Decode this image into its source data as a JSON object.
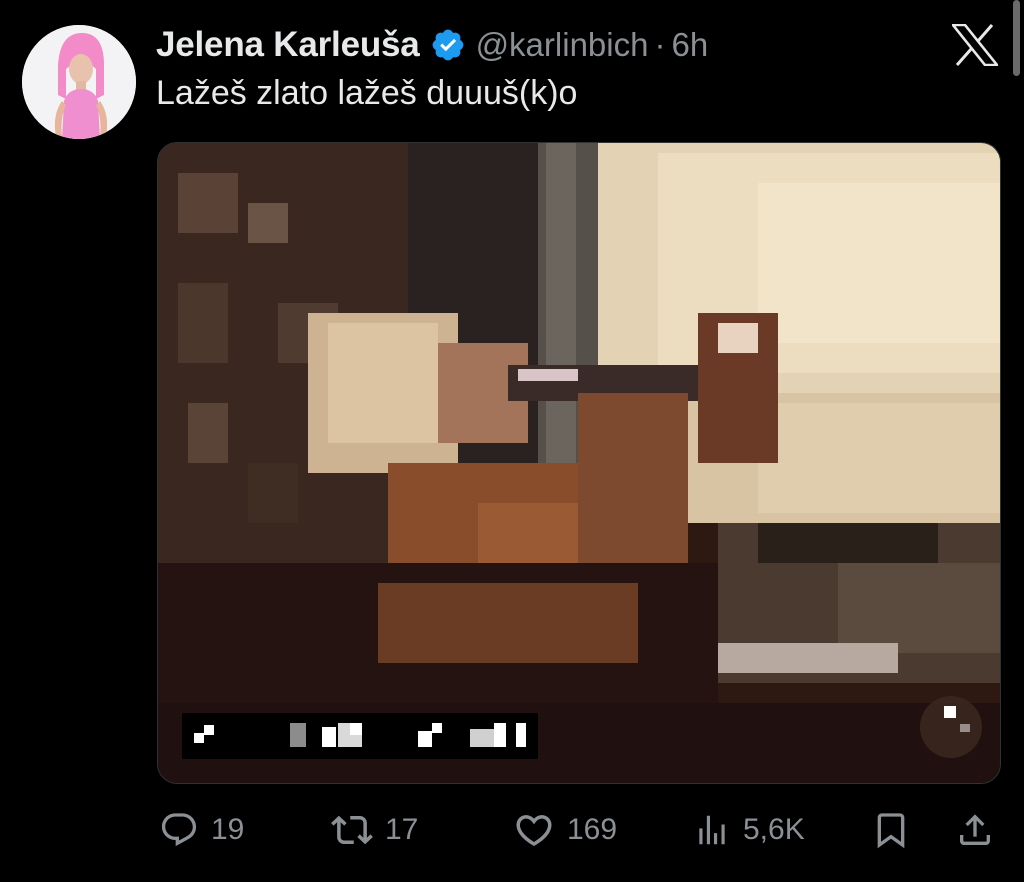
{
  "tweet": {
    "display_name": "Jelena Karleuša",
    "handle": "@karlinbich",
    "separator": "·",
    "time": "6h",
    "text": "Lažeš zlato lažeš duuuš(k)o",
    "verified": true
  },
  "icons": {
    "brand": "x-logo-icon",
    "verified": "verified-badge-icon",
    "reply": "reply-icon",
    "repost": "repost-icon",
    "like": "like-icon",
    "views": "views-icon",
    "bookmark": "bookmark-icon",
    "share": "share-icon"
  },
  "actions": {
    "replies": "19",
    "reposts": "17",
    "likes": "169",
    "views": "5,6K"
  },
  "colors": {
    "background": "#000000",
    "text": "#e7e9ea",
    "secondary": "#8b9095",
    "verified": "#1d9bf0"
  }
}
